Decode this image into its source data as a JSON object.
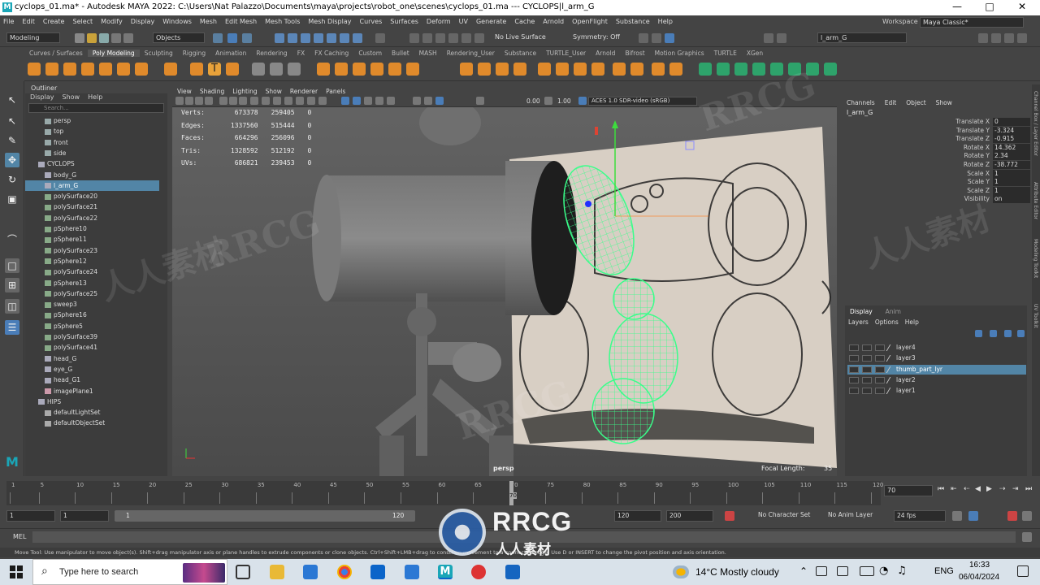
{
  "window": {
    "title": "cyclops_01.ma* - Autodesk MAYA 2022: C:\\Users\\Nat Palazzo\\Documents\\maya\\projects\\robot_one\\scenes\\cyclops_01.ma   ---   CYCLOPS|l_arm_G",
    "minimize": "—",
    "maximize": "□",
    "close": "✕"
  },
  "menubar": [
    "File",
    "Edit",
    "Create",
    "Select",
    "Modify",
    "Display",
    "Windows",
    "Mesh",
    "Edit Mesh",
    "Mesh Tools",
    "Mesh Display",
    "Curves",
    "Surfaces",
    "Deform",
    "UV",
    "Generate",
    "Cache",
    "Arnold",
    "OpenFlight",
    "Substance",
    "Help"
  ],
  "workspace": {
    "label": "Workspace :",
    "value": "Maya Classic*"
  },
  "statusline": {
    "mode": "Modeling",
    "objects": "Objects",
    "live_surface": "No Live Surface",
    "symmetry": "Symmetry: Off",
    "selected_name": "l_arm_G"
  },
  "shelf_tabs": [
    "Curves / Surfaces",
    "Poly Modeling",
    "Sculpting",
    "Rigging",
    "Animation",
    "Rendering",
    "FX",
    "FX Caching",
    "Custom",
    "Bullet",
    "MASH",
    "Rendering_User",
    "Substance",
    "TURTLE_User",
    "Arnold",
    "Bifrost",
    "Motion Graphics",
    "TURTLE",
    "XGen"
  ],
  "shelf_active": "Poly Modeling",
  "outliner": {
    "title": "Outliner",
    "menus": [
      "Display",
      "Show",
      "Help"
    ],
    "search_placeholder": "Search...",
    "items": [
      {
        "label": "persp",
        "type": "camera",
        "indent": 1
      },
      {
        "label": "top",
        "type": "camera",
        "indent": 1
      },
      {
        "label": "front",
        "type": "camera",
        "indent": 1
      },
      {
        "label": "side",
        "type": "camera",
        "indent": 1
      },
      {
        "label": "CYCLOPS",
        "type": "group",
        "indent": 0
      },
      {
        "label": "body_G",
        "type": "group",
        "indent": 1
      },
      {
        "label": "l_arm_G",
        "type": "group",
        "indent": 1,
        "selected": true
      },
      {
        "label": "polySurface20",
        "type": "mesh",
        "indent": 1
      },
      {
        "label": "polySurface21",
        "type": "mesh",
        "indent": 1
      },
      {
        "label": "polySurface22",
        "type": "mesh",
        "indent": 1
      },
      {
        "label": "pSphere10",
        "type": "mesh",
        "indent": 1
      },
      {
        "label": "pSphere11",
        "type": "mesh",
        "indent": 1
      },
      {
        "label": "polySurface23",
        "type": "mesh",
        "indent": 1
      },
      {
        "label": "pSphere12",
        "type": "mesh",
        "indent": 1
      },
      {
        "label": "polySurface24",
        "type": "mesh",
        "indent": 1
      },
      {
        "label": "pSphere13",
        "type": "mesh",
        "indent": 1
      },
      {
        "label": "polySurface25",
        "type": "mesh",
        "indent": 1
      },
      {
        "label": "sweep3",
        "type": "mesh",
        "indent": 1
      },
      {
        "label": "pSphere16",
        "type": "mesh",
        "indent": 1
      },
      {
        "label": "pSphere5",
        "type": "mesh",
        "indent": 1
      },
      {
        "label": "polySurface39",
        "type": "mesh",
        "indent": 1
      },
      {
        "label": "polySurface41",
        "type": "mesh",
        "indent": 1
      },
      {
        "label": "head_G",
        "type": "group",
        "indent": 1
      },
      {
        "label": "eye_G",
        "type": "group",
        "indent": 1
      },
      {
        "label": "head_G1",
        "type": "group",
        "indent": 1
      },
      {
        "label": "imagePlane1",
        "type": "image",
        "indent": 1
      },
      {
        "label": "HIPS",
        "type": "group",
        "indent": 0
      },
      {
        "label": "defaultLightSet",
        "type": "set",
        "indent": 1
      },
      {
        "label": "defaultObjectSet",
        "type": "set",
        "indent": 1
      }
    ]
  },
  "viewport": {
    "menus": [
      "View",
      "Shading",
      "Lighting",
      "Show",
      "Renderer",
      "Panels"
    ],
    "exposure": "0.00",
    "gamma": "1.00",
    "color_space": "ACES 1.0 SDR-video (sRGB)",
    "camera": "persp",
    "focal_label": "Focal Length:",
    "focal_value": "35",
    "hud": [
      {
        "label": "Verts:",
        "a": "673378",
        "b": "259405",
        "c": "0"
      },
      {
        "label": "Edges:",
        "a": "1337560",
        "b": "515444",
        "c": "0"
      },
      {
        "label": "Faces:",
        "a": "664296",
        "b": "256096",
        "c": "0"
      },
      {
        "label": "Tris:",
        "a": "1328592",
        "b": "512192",
        "c": "0"
      },
      {
        "label": "UVs:",
        "a": "686821",
        "b": "239453",
        "c": "0"
      }
    ]
  },
  "channelbox": {
    "menus": [
      "Channels",
      "Edit",
      "Object",
      "Show"
    ],
    "object": "l_arm_G",
    "attrs": [
      {
        "label": "Translate X",
        "value": "0"
      },
      {
        "label": "Translate Y",
        "value": "-3.324"
      },
      {
        "label": "Translate Z",
        "value": "-0.915"
      },
      {
        "label": "Rotate X",
        "value": "14.362"
      },
      {
        "label": "Rotate Y",
        "value": "2.34"
      },
      {
        "label": "Rotate Z",
        "value": "-38.772"
      },
      {
        "label": "Scale X",
        "value": "1"
      },
      {
        "label": "Scale Y",
        "value": "1"
      },
      {
        "label": "Scale Z",
        "value": "1"
      },
      {
        "label": "Visibility",
        "value": "on"
      }
    ]
  },
  "layer_editor": {
    "tabs": [
      "Display",
      "Anim"
    ],
    "menus": [
      "Layers",
      "Options",
      "Help"
    ],
    "layers": [
      {
        "label": "layer4"
      },
      {
        "label": "layer3"
      },
      {
        "label": "thumb_part_lyr",
        "selected": true
      },
      {
        "label": "layer2"
      },
      {
        "label": "layer1"
      }
    ]
  },
  "side_tabs": [
    "Channel Box / Layer Editor",
    "Attribute Editor",
    "Modeling Toolkit",
    "UV Toolkit"
  ],
  "timeslider": {
    "ticks": [
      "1",
      "5",
      "10",
      "15",
      "20",
      "25",
      "30",
      "35",
      "40",
      "45",
      "50",
      "55",
      "60",
      "65",
      "70",
      "75",
      "80",
      "85",
      "90",
      "95",
      "100",
      "105",
      "110",
      "115",
      "120"
    ],
    "current_frame_marker": "70",
    "current_frame": "70"
  },
  "range": {
    "start": "1",
    "start_inner": "1",
    "range_start": "1",
    "range_end": "120",
    "end_inner": "120",
    "end": "200",
    "character_set": "No Character Set",
    "anim_layer": "No Anim Layer",
    "fps": "24 fps"
  },
  "command": {
    "label": "MEL"
  },
  "help_line": "Move Tool: Use manipulator to move object(s). Shift+drag manipulator axis or plane handles to extrude components or clone objects. Ctrl+Shift+LMB+drag to constrain movement to a connected edge. Use D or INSERT to change the pivot position and axis orientation.",
  "taskbar": {
    "search_placeholder": "Type here to search",
    "weather": "14°C  Mostly cloudy",
    "lang": "ENG",
    "time": "16:33",
    "date": "06/04/2024"
  },
  "watermarks": [
    "RRCG",
    "人人素材"
  ],
  "colors": {
    "selection": "#5285a6",
    "wireframe": "#39ff8a",
    "maya_teal": "#1aa6b7"
  }
}
